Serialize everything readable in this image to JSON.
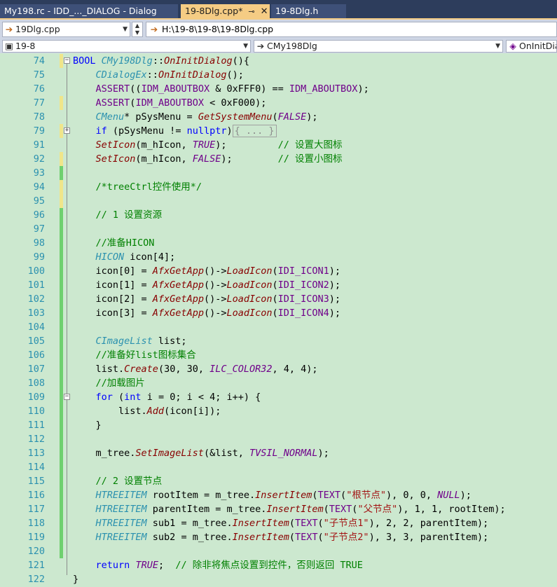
{
  "tabs": [
    {
      "label": "My198.rc - IDD_..._DIALOG - Dialog",
      "active": false
    },
    {
      "label": "19-8Dlg.cpp*",
      "active": true,
      "pin": "⊸",
      "close": "✕"
    },
    {
      "label": "19-8Dlg.h",
      "active": false
    }
  ],
  "toolbar": {
    "file_combo": "19Dlg.cpp",
    "path": "H:\\19-8\\19-8\\19-8Dlg.cpp",
    "project_combo": "19-8",
    "class_combo": "CMy198Dlg",
    "member_combo": "OnInitDia"
  },
  "icons": {
    "arrow": "arrow-right-icon",
    "dropdown": "chevron-down-icon"
  },
  "lines": [
    {
      "n": "74",
      "mark": "yellow",
      "fold": "−",
      "html": "<span class=\"kw\">BOOL</span> <span class=\"tp\">CMy198Dlg</span>::<span class=\"fn\">OnInitDialog</span>(){"
    },
    {
      "n": "75",
      "mark": "",
      "html": "    <span class=\"tp\">CDialogEx</span>::<span class=\"fn\">OnInitDialog</span>();"
    },
    {
      "n": "76",
      "mark": "",
      "html": "    <span class=\"mc\">ASSERT</span>((<span class=\"mc\">IDM_ABOUTBOX</span> &amp; 0xFFF0) == <span class=\"mc\">IDM_ABOUTBOX</span>);"
    },
    {
      "n": "77",
      "mark": "yellow",
      "html": "    <span class=\"mc\">ASSERT</span>(<span class=\"mc\">IDM_ABOUTBOX</span> &lt; 0xF000);"
    },
    {
      "n": "78",
      "mark": "",
      "html": "    <span class=\"tp\">CMenu</span>* pSysMenu = <span class=\"fn\">GetSystemMenu</span>(<span class=\"mc ital\">FALSE</span>);"
    },
    {
      "n": "79",
      "mark": "yellow",
      "fold": "+",
      "html": "    <span class=\"kw\">if</span> (pSysMenu != <span class=\"kw\">nullptr</span>)<span class=\"collapsed\">{ ... }</span>"
    },
    {
      "n": "91",
      "mark": "",
      "html": "    <span class=\"fn\">SetIcon</span>(m_hIcon, <span class=\"mc ital\">TRUE</span>);         <span class=\"cm\">// 设置大图标</span>"
    },
    {
      "n": "92",
      "mark": "yellow",
      "html": "    <span class=\"fn\">SetIcon</span>(m_hIcon, <span class=\"mc ital\">FALSE</span>);        <span class=\"cm\">// 设置小图标</span>"
    },
    {
      "n": "93",
      "mark": "green",
      "html": ""
    },
    {
      "n": "94",
      "mark": "yellow",
      "html": "    <span class=\"cm\">/*treeCtrl控件使用*/</span>"
    },
    {
      "n": "95",
      "mark": "yellow",
      "html": ""
    },
    {
      "n": "96",
      "mark": "green",
      "html": "    <span class=\"cm\">// 1 设置资源</span>"
    },
    {
      "n": "97",
      "mark": "green",
      "html": ""
    },
    {
      "n": "98",
      "mark": "green",
      "html": "    <span class=\"cm\">//准备HICON</span>"
    },
    {
      "n": "99",
      "mark": "green",
      "html": "    <span class=\"tp\">HICON</span> icon[4];"
    },
    {
      "n": "100",
      "mark": "green",
      "html": "    icon[0] = <span class=\"fn\">AfxGetApp</span>()-&gt;<span class=\"fn\">LoadIcon</span>(<span class=\"mc\">IDI_ICON1</span>);"
    },
    {
      "n": "101",
      "mark": "green",
      "html": "    icon[1] = <span class=\"fn\">AfxGetApp</span>()-&gt;<span class=\"fn\">LoadIcon</span>(<span class=\"mc\">IDI_ICON2</span>);"
    },
    {
      "n": "102",
      "mark": "green",
      "html": "    icon[2] = <span class=\"fn\">AfxGetApp</span>()-&gt;<span class=\"fn\">LoadIcon</span>(<span class=\"mc\">IDI_ICON3</span>);"
    },
    {
      "n": "103",
      "mark": "green",
      "html": "    icon[3] = <span class=\"fn\">AfxGetApp</span>()-&gt;<span class=\"fn\">LoadIcon</span>(<span class=\"mc\">IDI_ICON4</span>);"
    },
    {
      "n": "104",
      "mark": "green",
      "html": ""
    },
    {
      "n": "105",
      "mark": "green",
      "html": "    <span class=\"tp\">CImageList</span> list;"
    },
    {
      "n": "106",
      "mark": "green",
      "html": "    <span class=\"cm\">//准备好list图标集合</span>"
    },
    {
      "n": "107",
      "mark": "green",
      "html": "    list.<span class=\"fn\">Create</span>(30, 30, <span class=\"mc ital\">ILC_COLOR32</span>, 4, 4);"
    },
    {
      "n": "108",
      "mark": "green",
      "html": "    <span class=\"cm\">//加载图片</span>"
    },
    {
      "n": "109",
      "mark": "green",
      "fold": "−",
      "html": "    <span class=\"kw\">for</span> (<span class=\"kw\">int</span> i = 0; i &lt; 4; i++) {"
    },
    {
      "n": "110",
      "mark": "green",
      "html": "        list.<span class=\"fn\">Add</span>(icon[i]);"
    },
    {
      "n": "111",
      "mark": "green",
      "html": "    }"
    },
    {
      "n": "112",
      "mark": "green",
      "html": ""
    },
    {
      "n": "113",
      "mark": "green",
      "html": "    m_tree.<span class=\"fn\">SetImageList</span>(&amp;list, <span class=\"mc ital\">TVSIL_NORMAL</span>);"
    },
    {
      "n": "114",
      "mark": "green",
      "html": ""
    },
    {
      "n": "115",
      "mark": "green",
      "html": "    <span class=\"cm\">// 2 设置节点</span>"
    },
    {
      "n": "116",
      "mark": "green",
      "html": "    <span class=\"tp\">HTREEITEM</span> rootItem = m_tree.<span class=\"fn\">InsertItem</span>(<span class=\"mc\">TEXT</span>(<span class=\"st\">\"根节点\"</span>), 0, 0, <span class=\"mc ital\">NULL</span>);"
    },
    {
      "n": "117",
      "mark": "green",
      "html": "    <span class=\"tp\">HTREEITEM</span> parentItem = m_tree.<span class=\"fn\">InsertItem</span>(<span class=\"mc\">TEXT</span>(<span class=\"st\">\"父节点\"</span>), 1, 1, rootItem);"
    },
    {
      "n": "118",
      "mark": "green",
      "html": "    <span class=\"tp\">HTREEITEM</span> sub1 = m_tree.<span class=\"fn\">InsertItem</span>(<span class=\"mc\">TEXT</span>(<span class=\"st\">\"子节点1\"</span>), 2, 2, parentItem);"
    },
    {
      "n": "119",
      "mark": "green",
      "html": "    <span class=\"tp\">HTREEITEM</span> sub2 = m_tree.<span class=\"fn\">InsertItem</span>(<span class=\"mc\">TEXT</span>(<span class=\"st\">\"子节点2\"</span>), 3, 3, parentItem);"
    },
    {
      "n": "120",
      "mark": "green",
      "html": ""
    },
    {
      "n": "121",
      "mark": "",
      "html": "    <span class=\"kw\">return</span> <span class=\"mc ital\">TRUE</span>;  <span class=\"cm\">// 除非将焦点设置到控件，否则返回 TRUE</span>"
    },
    {
      "n": "122",
      "mark": "",
      "html": "}"
    }
  ]
}
